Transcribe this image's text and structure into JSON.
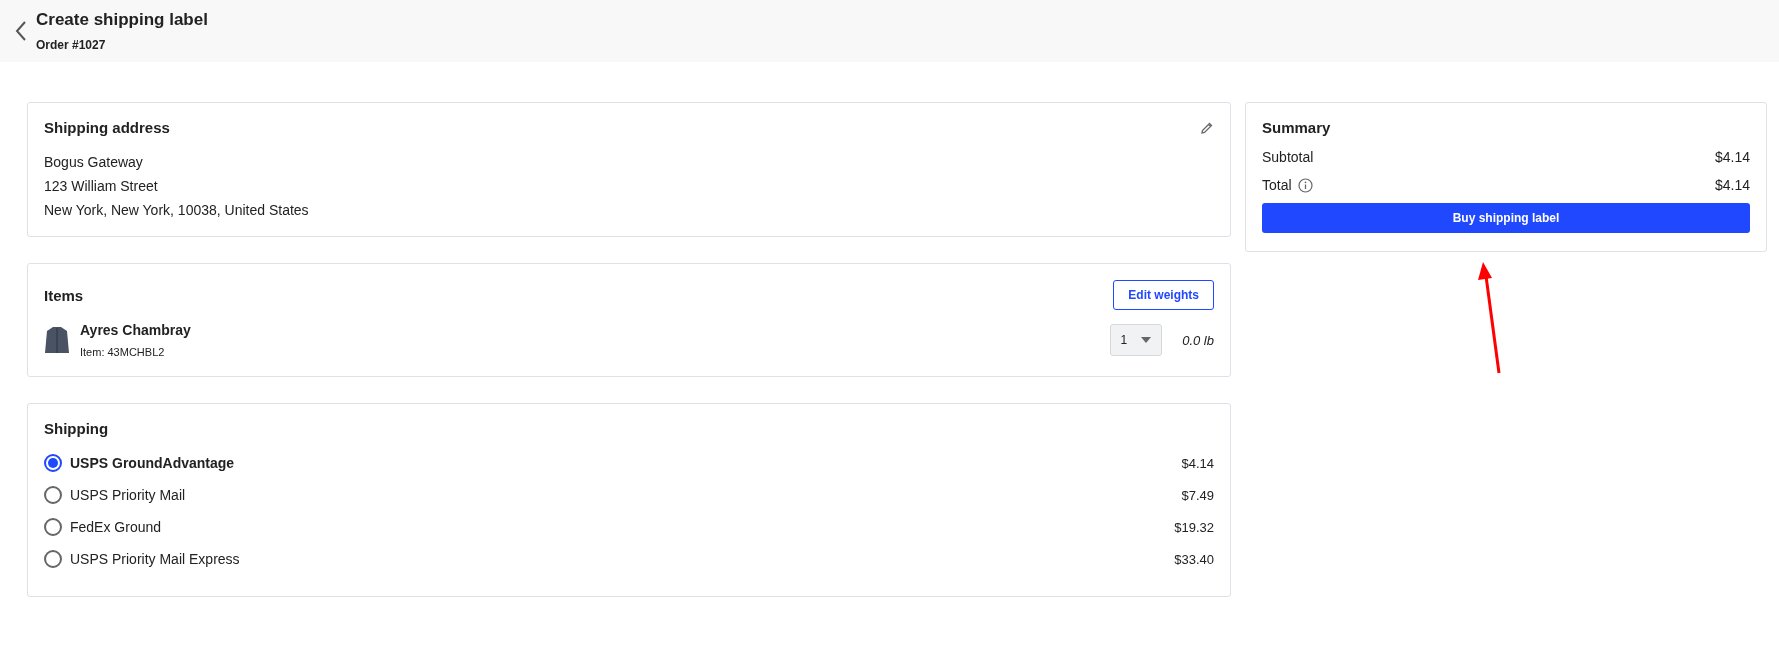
{
  "header": {
    "title": "Create shipping label",
    "subtitle": "Order #1027"
  },
  "shipping_address": {
    "title": "Shipping address",
    "lines": [
      "Bogus Gateway",
      "123 William Street",
      "New York, New York, 10038, United States"
    ]
  },
  "items": {
    "title": "Items",
    "edit_button": "Edit weights",
    "list": [
      {
        "name": "Ayres Chambray",
        "sku": "Item: 43MCHBL2",
        "quantity": "1",
        "weight": "0.0 lb"
      }
    ]
  },
  "shipping": {
    "title": "Shipping",
    "options": [
      {
        "label": "USPS GroundAdvantage",
        "price": "$4.14",
        "selected": true
      },
      {
        "label": "USPS Priority Mail",
        "price": "$7.49",
        "selected": false
      },
      {
        "label": "FedEx Ground",
        "price": "$19.32",
        "selected": false
      },
      {
        "label": "USPS Priority Mail Express",
        "price": "$33.40",
        "selected": false
      }
    ]
  },
  "summary": {
    "title": "Summary",
    "rows": [
      {
        "label": "Subtotal",
        "value": "$4.14",
        "info": false
      },
      {
        "label": "Total",
        "value": "$4.14",
        "info": true
      }
    ],
    "button": "Buy shipping label"
  }
}
